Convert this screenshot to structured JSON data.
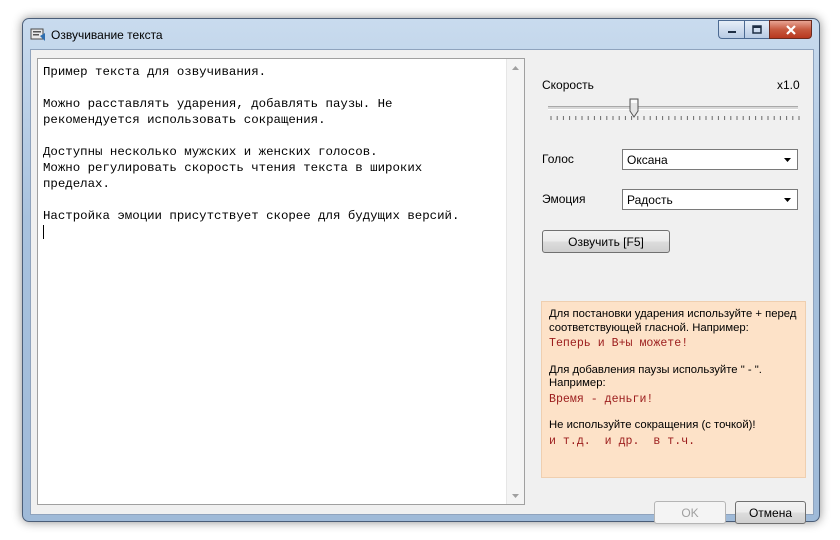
{
  "window": {
    "title": "Озвучивание текста",
    "accent_color": "#a8c2de",
    "caption_buttons": [
      "minimize-icon",
      "maximize-icon",
      "close-icon"
    ]
  },
  "editor": {
    "lines": [
      "Пример текста для озвучивания.",
      "",
      "Можно расставлять ударения, добавлять паузы. Не",
      "рекомендуется использовать сокращения.",
      "",
      "Доступны несколько мужских и женских голосов.",
      "Можно регулировать скорость чтения текста в широких",
      "пределах.",
      "",
      "Настройка эмоции присутствует скорее для будущих версий."
    ]
  },
  "speed": {
    "label": "Скорость",
    "value_text": "x1.0",
    "value": 1.0
  },
  "voice": {
    "label": "Голос",
    "selected": "Оксана"
  },
  "emotion": {
    "label": "Эмоция",
    "selected": "Радость"
  },
  "speak_button": {
    "label": "Озвучить [F5]"
  },
  "info": {
    "stress_text": "Для постановки ударения используйте + перед соответствующей гласной. Например:",
    "stress_example": "Теперь и В+ы можете!",
    "pause_text": "Для добавления паузы используйте \" - \". Например:",
    "pause_example": "Время - деньги!",
    "abbr_text": "Не используйте сокращения (с точкой)!",
    "abbr_example": "и т.д.  и др.  в т.ч.",
    "bg_color": "#fde2c8",
    "example_color": "#9b1c1c"
  },
  "footer": {
    "ok_label": "OK",
    "cancel_label": "Отмена"
  }
}
